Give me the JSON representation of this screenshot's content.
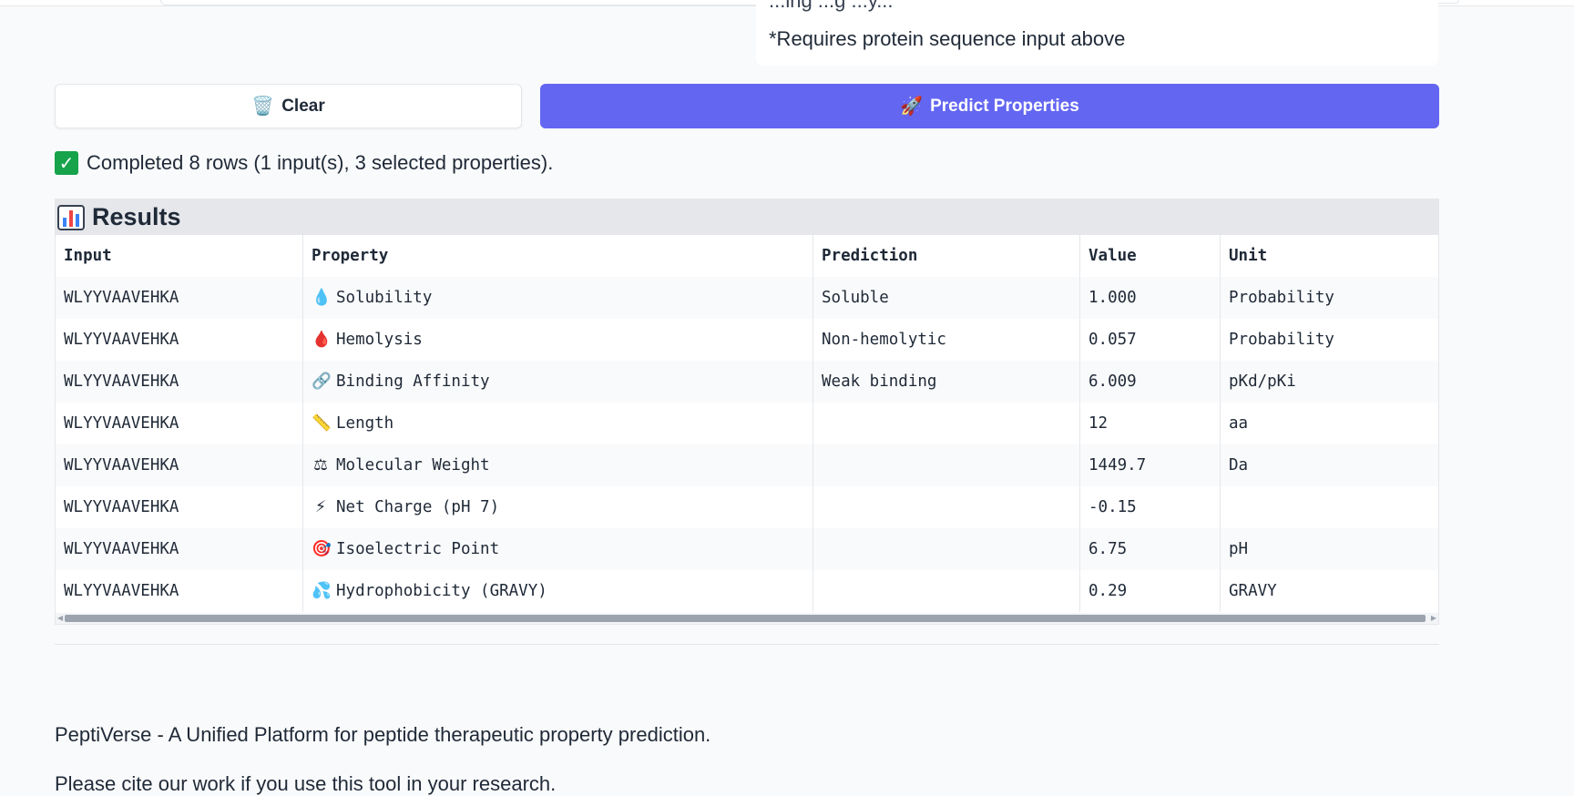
{
  "note": {
    "partial_text": "...ing ...g ...y...",
    "text": "*Requires protein sequence input above"
  },
  "buttons": {
    "clear_icon": "🗑️",
    "clear_label": "Clear",
    "predict_icon": "🚀",
    "predict_label": "Predict Properties"
  },
  "status": {
    "icon": "✓",
    "text": "Completed 8 rows (1 input(s), 3 selected properties)."
  },
  "results": {
    "title": "Results",
    "columns": [
      "Input",
      "Property",
      "Prediction",
      "Value",
      "Unit"
    ],
    "rows": [
      {
        "input": "WLYYVAAVEHKA",
        "icon": "💧",
        "property": "Solubility",
        "prediction": "Soluble",
        "value": "1.000",
        "unit": "Probability"
      },
      {
        "input": "WLYYVAAVEHKA",
        "icon": "🩸",
        "property": "Hemolysis",
        "prediction": "Non-hemolytic",
        "value": "0.057",
        "unit": "Probability"
      },
      {
        "input": "WLYYVAAVEHKA",
        "icon": "🔗",
        "property": "Binding Affinity",
        "prediction": "Weak binding",
        "value": "6.009",
        "unit": "pKd/pKi"
      },
      {
        "input": "WLYYVAAVEHKA",
        "icon": "📏",
        "property": "Length",
        "prediction": "",
        "value": "12",
        "unit": "aa"
      },
      {
        "input": "WLYYVAAVEHKA",
        "icon": "⚖",
        "property": "Molecular Weight",
        "prediction": "",
        "value": "1449.7",
        "unit": "Da"
      },
      {
        "input": "WLYYVAAVEHKA",
        "icon": "⚡",
        "property": "Net Charge (pH 7)",
        "prediction": "",
        "value": "-0.15",
        "unit": ""
      },
      {
        "input": "WLYYVAAVEHKA",
        "icon": "🎯",
        "property": "Isoelectric Point",
        "prediction": "",
        "value": "6.75",
        "unit": "pH"
      },
      {
        "input": "WLYYVAAVEHKA",
        "icon": "💦",
        "property": "Hydrophobicity (GRAVY)",
        "prediction": "",
        "value": "0.29",
        "unit": "GRAVY"
      }
    ]
  },
  "footer": {
    "text": "PeptiVerse - A Unified Platform for peptide therapeutic property prediction.",
    "partial_text": "Please cite our work if you use this tool in your research."
  },
  "colors": {
    "primary": "#6366f1",
    "success": "#16a34a",
    "header_bg": "#e5e7eb"
  }
}
